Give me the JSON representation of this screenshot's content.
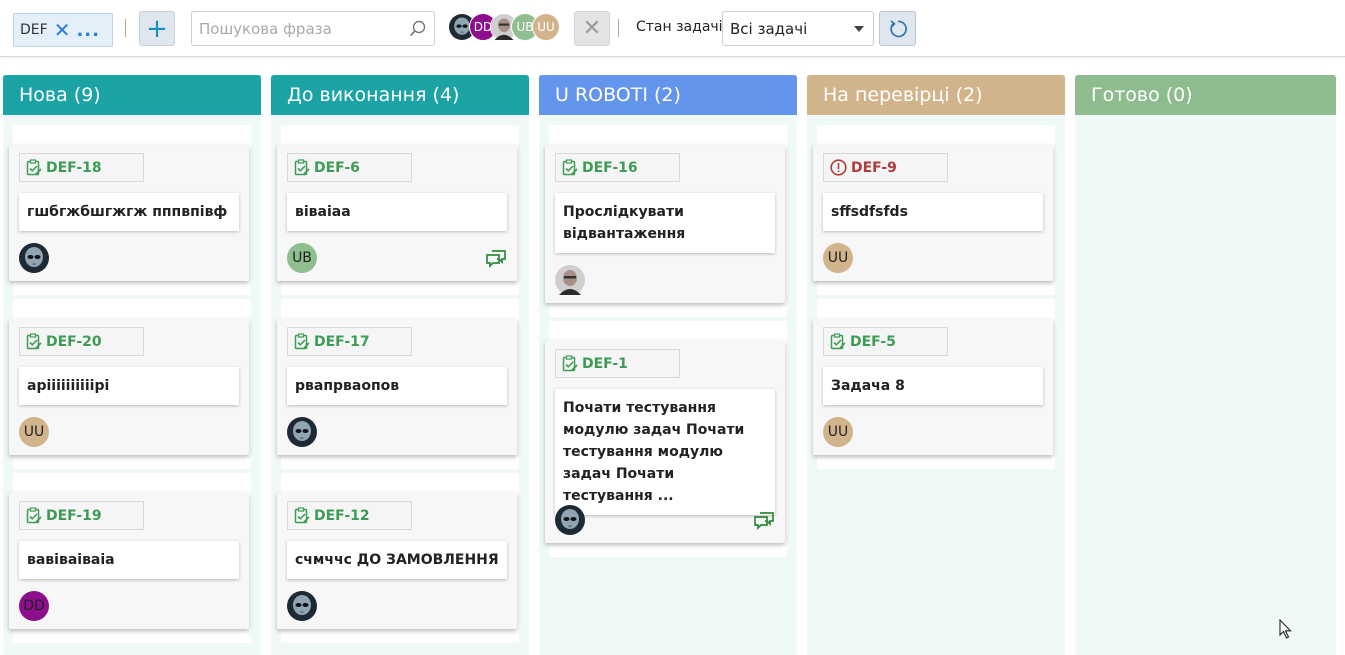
{
  "toolbar": {
    "project_code": "DEF",
    "project_more": "...",
    "search_placeholder": "Пошукова фраза",
    "avatars": [
      {
        "kind": "photo-alien"
      },
      {
        "initials": "DD",
        "color": "#8e0f8e"
      },
      {
        "kind": "photo-man"
      },
      {
        "initials": "UB",
        "color": "#8fbf8f"
      },
      {
        "initials": "UU",
        "color": "#d2b48c"
      }
    ],
    "status_label": "Стан задачі",
    "status_value": "Всі задачі"
  },
  "columns": [
    {
      "title": "Нова (9)",
      "color": "#1ba3a6",
      "cards": [
        {
          "key": "DEF-18",
          "type": "task",
          "title": "гшбгжбшгжгж пппвпівф",
          "assignee": {
            "kind": "photo-alien"
          },
          "comment": false
        },
        {
          "key": "DEF-20",
          "type": "task",
          "title": "аріііііііііірі",
          "assignee": {
            "initials": "UU",
            "color": "#d2b48c"
          },
          "comment": false
        },
        {
          "key": "DEF-19",
          "type": "task",
          "title": "вавіваіваіа",
          "assignee": {
            "initials": "DD",
            "color": "#8e0f8e"
          },
          "comment": false
        }
      ]
    },
    {
      "title": "До виконання (4)",
      "color": "#1ba3a6",
      "cards": [
        {
          "key": "DEF-6",
          "type": "task",
          "title": "віваіаа",
          "assignee": {
            "initials": "UB",
            "color": "#8fbf8f"
          },
          "comment": true
        },
        {
          "key": "DEF-17",
          "type": "task",
          "title": "рвапрваопов",
          "assignee": {
            "kind": "photo-alien"
          },
          "comment": false
        },
        {
          "key": "DEF-12",
          "type": "task",
          "title": "счмччс ДО ЗАМОВЛЕННЯ",
          "assignee": {
            "kind": "photo-alien"
          },
          "comment": false
        }
      ]
    },
    {
      "title": "U ROBOTI (2)",
      "color": "#6495ed",
      "cards": [
        {
          "key": "DEF-16",
          "type": "task",
          "title": "Прослідкувати відвантаження",
          "assignee": {
            "kind": "photo-man"
          },
          "comment": false
        },
        {
          "key": "DEF-1",
          "type": "task",
          "title": "Почати тестування модулю задач Почати тестування модулю задач Почати тестування ...",
          "assignee": {
            "kind": "photo-alien"
          },
          "comment": true
        }
      ]
    },
    {
      "title": "На перевірці (2)",
      "color": "#d2b48c",
      "cards": [
        {
          "key": "DEF-9",
          "type": "bug",
          "title": "sffsdfsfds",
          "assignee": {
            "initials": "UU",
            "color": "#d2b48c"
          },
          "comment": false
        },
        {
          "key": "DEF-5",
          "type": "task",
          "title": "Задача 8",
          "assignee": {
            "initials": "UU",
            "color": "#d2b48c"
          },
          "comment": false
        }
      ]
    },
    {
      "title": "Готово (0)",
      "color": "#8fbc8f",
      "cards": []
    }
  ]
}
